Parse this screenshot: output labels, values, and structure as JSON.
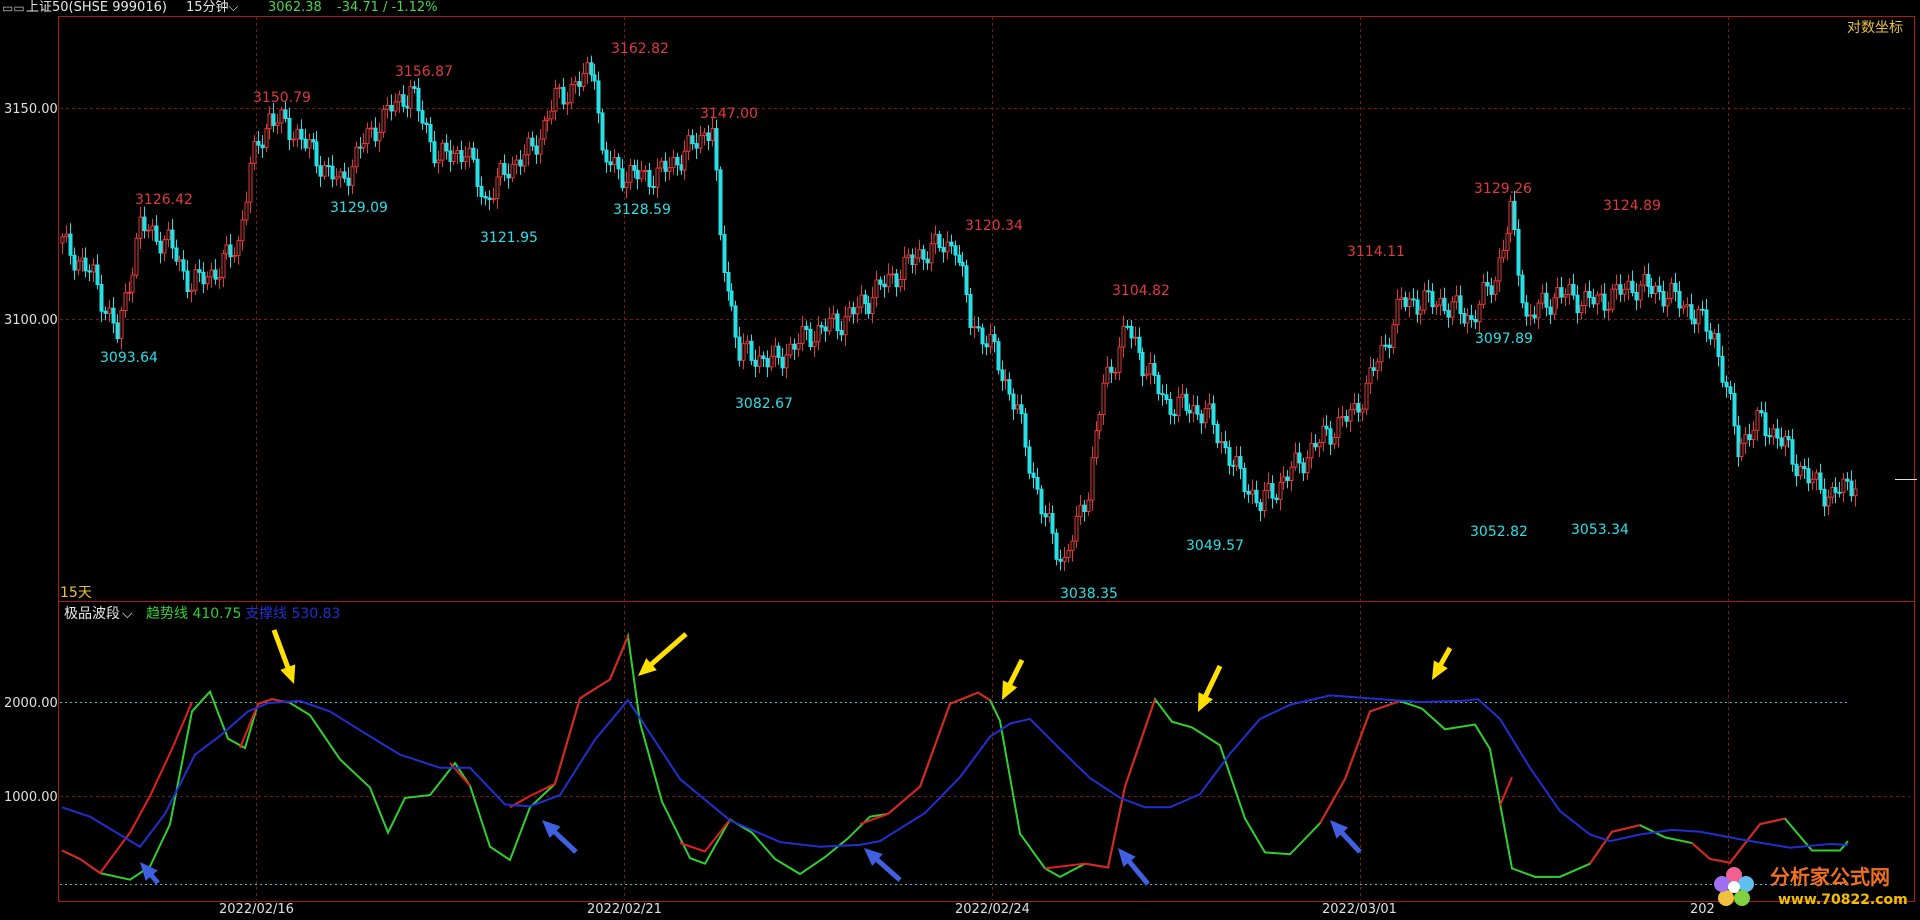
{
  "header": {
    "window_icon": "window-icon",
    "symbol": "上证50(SHSE 999016)",
    "period": "15分钟",
    "price": "3062.38",
    "change": "-34.71 / -1.12%"
  },
  "main_panel": {
    "log_axis_label": "对数坐标",
    "span_label": "15天",
    "y_axis_labels": [
      "3150.00",
      "3100.00"
    ],
    "price_annotations": {
      "highs": [
        "3126.42",
        "3150.79",
        "3156.87",
        "3162.82",
        "3147.00",
        "3120.34",
        "3104.82",
        "3114.11",
        "3129.26",
        "3124.89"
      ],
      "lows": [
        "3093.64",
        "3129.09",
        "3121.95",
        "3128.59",
        "3082.67",
        "3038.35",
        "3049.57",
        "3097.89",
        "3052.82",
        "3053.34"
      ]
    }
  },
  "indicator_panel": {
    "name": "极品波段",
    "trend_label": "趋势线 410.75",
    "support_label": "支撑线 530.83",
    "y_axis_labels": [
      "2000.00",
      "1000.00"
    ]
  },
  "x_axis": {
    "dates": [
      "2022/02/16",
      "2022/02/21",
      "2022/02/24",
      "2022/03/01",
      "202"
    ]
  },
  "watermark": {
    "title": "分析家公式网",
    "url": "www.70822.com"
  },
  "colors": {
    "up": "#e03a3a",
    "down": "#26e0e6",
    "trend": "#e02020",
    "trend_down": "#30d030",
    "support": "#2030d0",
    "frame": "#b01818",
    "arrow_sell": "#ffe000",
    "arrow_buy": "#4060e0"
  }
}
